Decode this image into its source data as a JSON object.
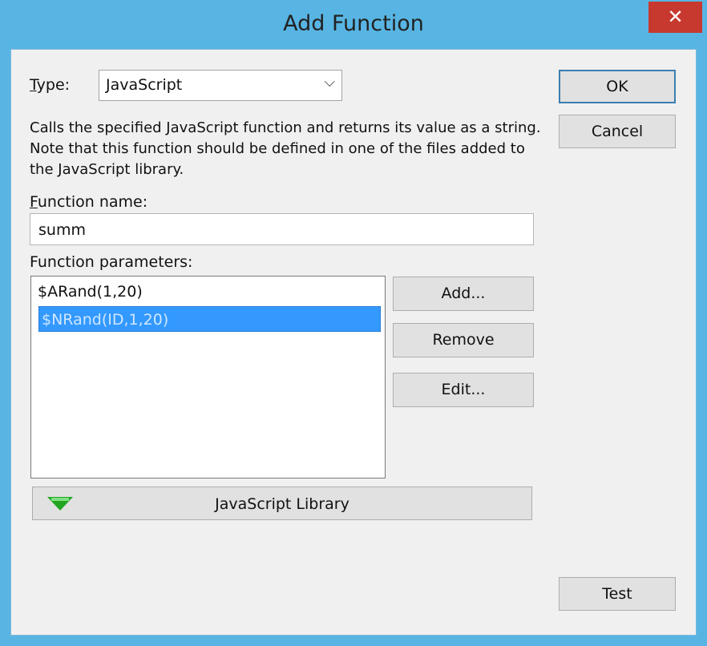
{
  "window": {
    "title": "Add Function",
    "close_glyph": "✕"
  },
  "type_field": {
    "label_first": "T",
    "label_rest": "ype:",
    "value": "JavaScript",
    "chevron": "⌵"
  },
  "description": "Calls the specified JavaScript function and returns its value as a string. Note that this function should be defined in one of the files added to the JavaScript library.",
  "function_name": {
    "label_first": "F",
    "label_rest": "unction name:",
    "value": "summ"
  },
  "function_parameters": {
    "label": "Function parameters:",
    "items": [
      "$ARand(1,20)",
      "$NRand(ID,1,20)"
    ],
    "selected_index": 1
  },
  "buttons": {
    "ok": "OK",
    "cancel": "Cancel",
    "add": "Add...",
    "remove": "Remove",
    "edit": "Edit...",
    "test": "Test"
  },
  "library": {
    "label": "JavaScript Library",
    "icon": "expand-triangle-icon"
  },
  "colors": {
    "title_bar": "#58b5e3",
    "close": "#c7392f",
    "selection": "#3399ff",
    "icon_green": "#22a622"
  }
}
